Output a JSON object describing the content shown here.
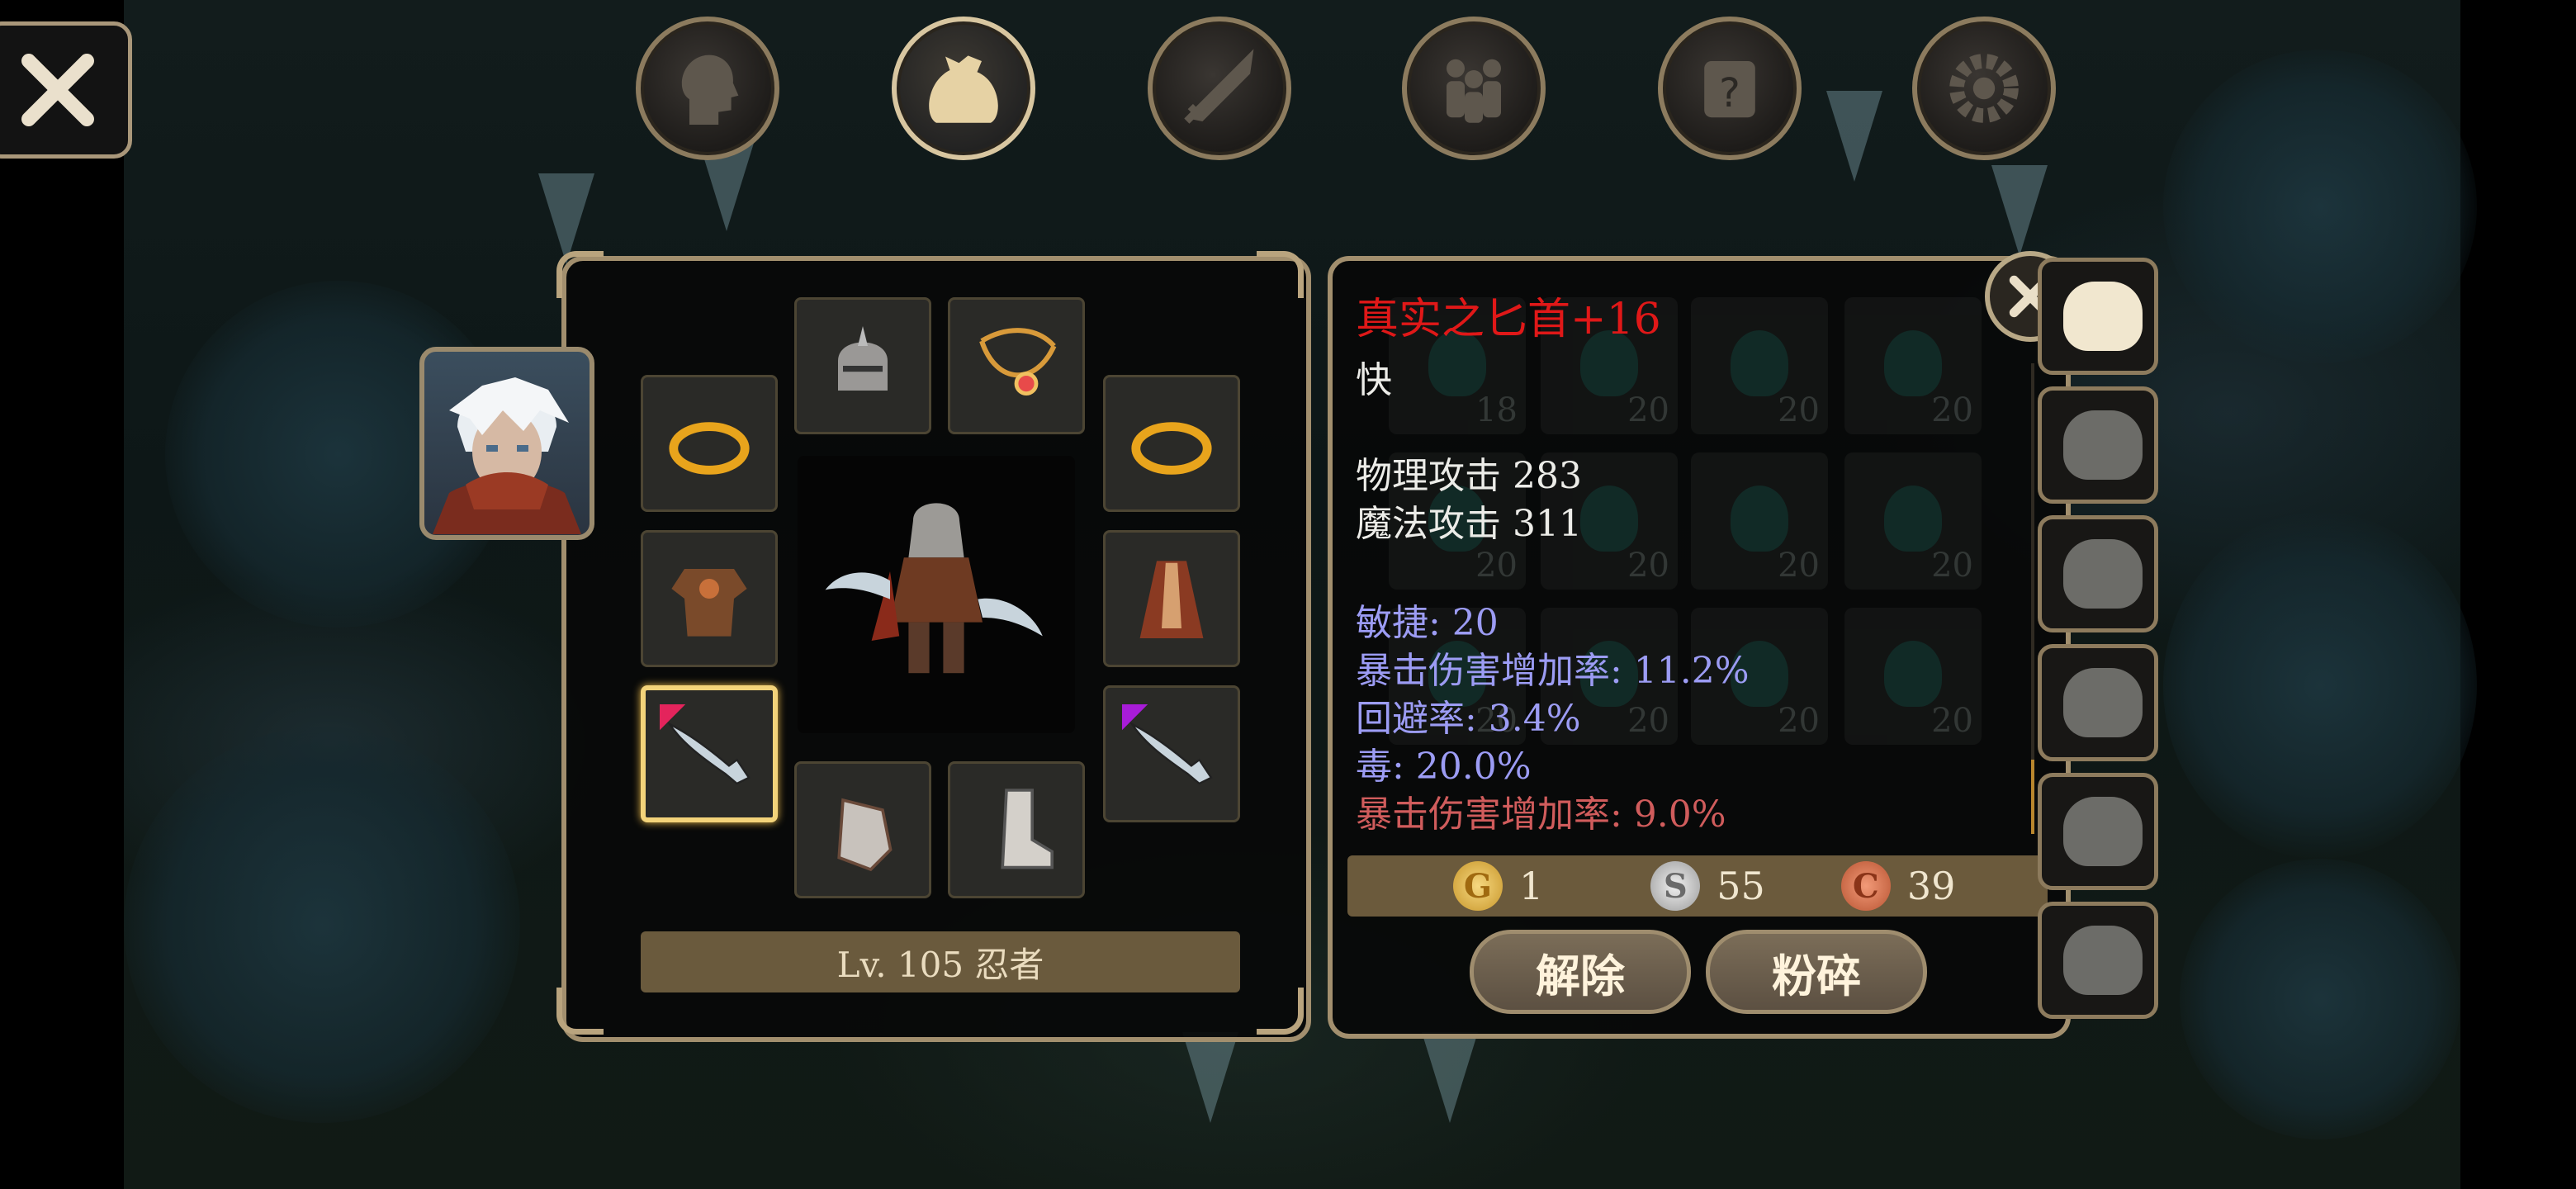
{
  "top_tabs": [
    {
      "name": "character",
      "icon": "head-icon",
      "active": false
    },
    {
      "name": "inventory",
      "icon": "bag-icon",
      "active": true
    },
    {
      "name": "skills",
      "icon": "sword-icon",
      "active": false
    },
    {
      "name": "party",
      "icon": "people-icon",
      "active": false
    },
    {
      "name": "quests",
      "icon": "scroll-icon",
      "active": false
    },
    {
      "name": "settings",
      "icon": "gear-icon",
      "active": false
    }
  ],
  "equipment": {
    "level_label": "Lv. 105 忍者",
    "slots": [
      "helmet-icon",
      "necklace-icon",
      "ring-icon",
      "ring-icon",
      "armor-icon",
      "cloak-icon",
      "dagger-icon",
      "gauntlet-icon",
      "boots-icon",
      "dagger-icon"
    ]
  },
  "item_detail": {
    "name": "真实之匕首+16",
    "speed": "快",
    "stats": [
      "物理攻击 283",
      "魔法攻击 311"
    ],
    "bonuses": [
      "敏捷: 20",
      "暴击伤害增加率: 11.2%",
      "回避率: 3.4%",
      "毒: 20.0%"
    ],
    "penalty": "暴击伤害增加率: 9.0%",
    "currency": {
      "gold": "1",
      "silver": "55",
      "copper": "39",
      "gold_symbol": "G",
      "silver_symbol": "S",
      "copper_symbol": "C"
    },
    "buttons": {
      "unequip": "解除",
      "smash": "粉碎"
    }
  },
  "inventory_ghost_counts": [
    "18",
    "20",
    "20",
    "20",
    "20",
    "20",
    "20",
    "20",
    "20",
    "20",
    "20",
    "20"
  ],
  "colors": {
    "accent_gold": "#a28f6e",
    "item_name_red": "#e01818",
    "bonus_blue": "#9c9cf4",
    "penalty_red": "#d05c5c"
  }
}
